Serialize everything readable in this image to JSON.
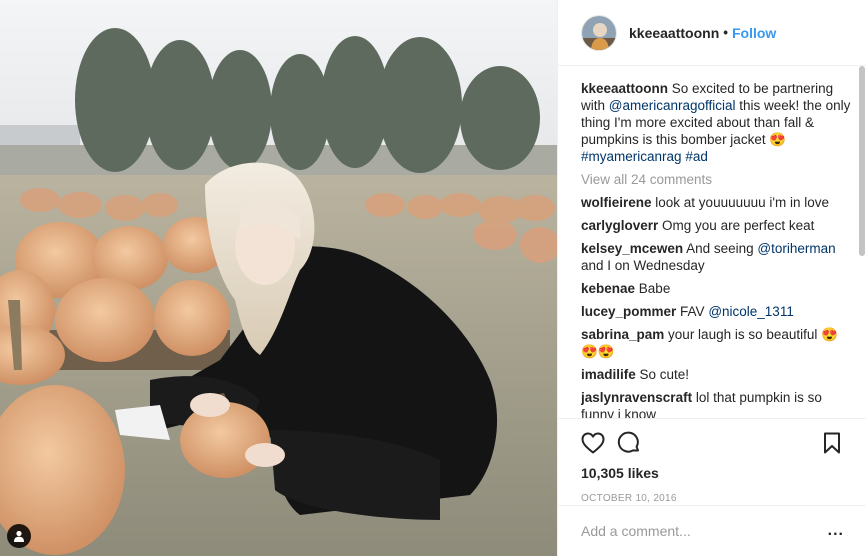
{
  "post": {
    "username": "kkeeaattoonn",
    "separator": "•",
    "follow_label": "Follow"
  },
  "caption": {
    "username": "kkeeaattoonn",
    "text_1": " So excited to be partnering with ",
    "mention": "@americanragofficial",
    "text_2": " this week! the only thing I'm more excited about than fall & pumpkins is this bomber jacket ",
    "emoji": "😍",
    "hashtag_1": "#myamericanrag",
    "hashtag_2": "#ad"
  },
  "view_all_label": "View all 24 comments",
  "comments": [
    {
      "user": "wolfieirene",
      "text": " look at youuuuuuu i'm in love"
    },
    {
      "user": "carlygloverr",
      "text": " Omg you are perfect keat"
    },
    {
      "user": "kelsey_mcewen",
      "text": " And seeing ",
      "mention": "@toriherman",
      "text_after": " and I on Wednesday"
    },
    {
      "user": "kebenae",
      "text": " Babe"
    },
    {
      "user": "lucey_pommer",
      "text": " FAV ",
      "mention": "@nicole_1311"
    },
    {
      "user": "sabrina_pam",
      "text": " your laugh is so beautiful ",
      "emoji": "😍😍😍"
    },
    {
      "user": "imadilife",
      "text": " So cute!"
    },
    {
      "user": "jaslynravenscraft",
      "text": " lol that pumpkin is so funny i know"
    }
  ],
  "likes": "10,305 likes",
  "date": "October 10, 2016",
  "add_comment_placeholder": "Add a comment...",
  "more_label": "...",
  "icons": {
    "like": "heart-icon",
    "comment": "comment-icon",
    "save": "bookmark-icon",
    "tag": "person-tag-icon"
  },
  "colors": {
    "link": "#3897f0",
    "mention": "#003569",
    "muted": "#999999",
    "text": "#262626"
  }
}
